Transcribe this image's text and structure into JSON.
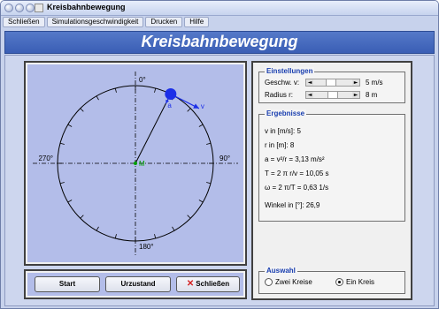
{
  "window": {
    "title": "Kreisbahnbewegung"
  },
  "menu": [
    "Schließen",
    "Simulationsgeschwindigkeit",
    "Drucken",
    "Hilfe"
  ],
  "banner": {
    "title": "Kreisbahnbewegung"
  },
  "simulation": {
    "angle_labels": {
      "top": "0°",
      "right": "90°",
      "bottom": "180°",
      "left": "270°"
    },
    "center_label": "M",
    "vector_a_label": "a",
    "vector_v_label": "v",
    "angle_deg": 26.9,
    "colors": {
      "circle": "#000000",
      "ball": "#1c2fe8",
      "velocity": "#1c2fe8",
      "center": "#00a000",
      "background": "#b3bde9"
    }
  },
  "buttons": {
    "start": "Start",
    "reset": "Urzustand",
    "close": "Schließen",
    "close_mark": "✕"
  },
  "settings": {
    "title": "Einstellungen",
    "speed_label": "Geschw. v:",
    "speed_value": "5 m/s",
    "speed_fraction": 0.45,
    "radius_label": "Radius r:",
    "radius_value": "8 m",
    "radius_fraction": 0.5
  },
  "results": {
    "title": "Ergebnisse",
    "lines": [
      "v in [m/s]:  5",
      "r in [m]:  8",
      "a  =  v²/r  =  3,13 m/s²",
      "T  =  2 π r/v  =  10,05 s",
      "ω   =  2 π/T  =  0,63 1/s",
      "Winkel in [°]:  26,9"
    ]
  },
  "selection": {
    "title": "Auswahl",
    "options": [
      {
        "label": "Zwei Kreise",
        "selected": false
      },
      {
        "label": "Ein Kreis",
        "selected": true
      }
    ]
  }
}
